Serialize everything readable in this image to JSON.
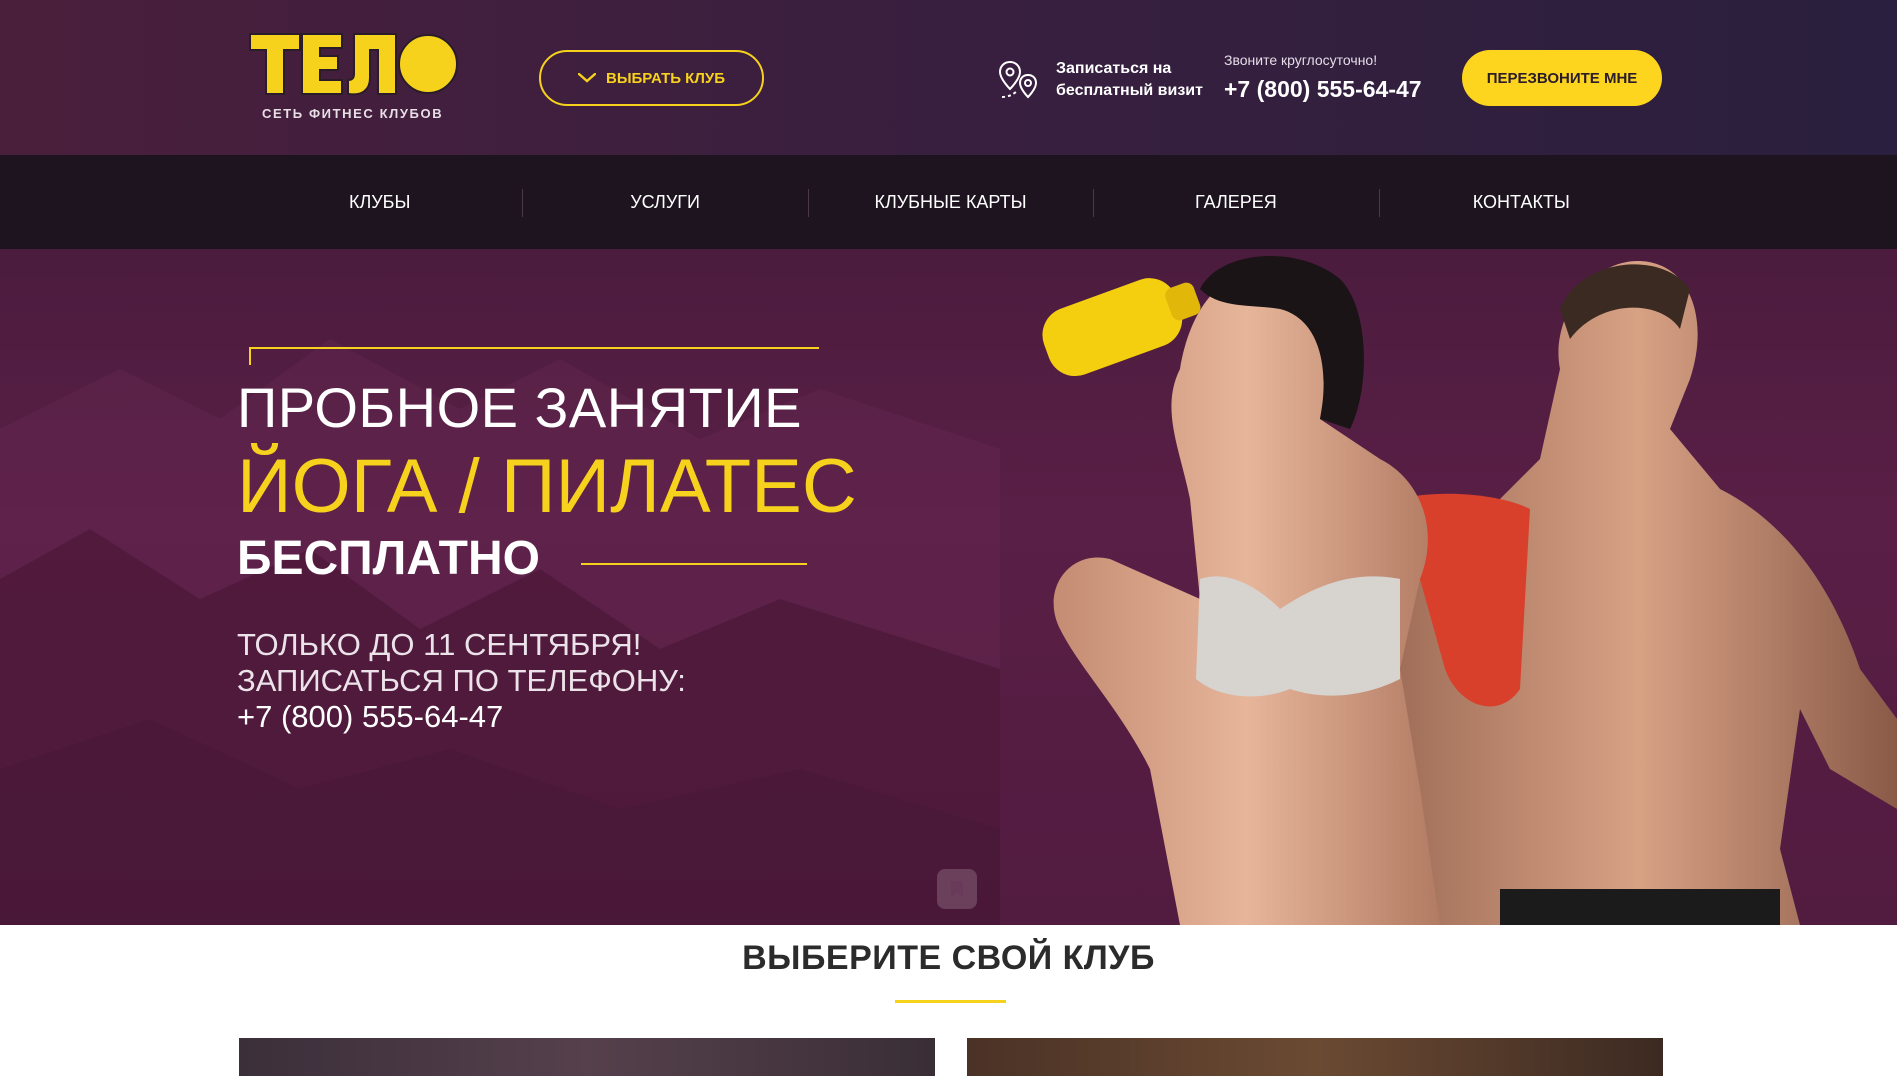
{
  "colors": {
    "accent": "#f7d21c",
    "header_bg": "#3a1f3f",
    "nav_bg": "#1d1420",
    "hero_bg": "#521b40"
  },
  "header": {
    "logo_text": "ТЕЛО",
    "logo_subtitle": "СЕТЬ ФИТНЕС КЛУБОВ",
    "select_club_label": "ВЫБРАТЬ КЛУБ",
    "select_club_icon": "chevron-down-icon",
    "visit_icon": "map-pin-route-icon",
    "visit_line1": "Записаться на",
    "visit_line2": "бесплатный визит",
    "phone_note": "Звоните круглосуточно!",
    "phone": "+7 (800) 555-64-47",
    "callback_label": "ПЕРЕЗВОНИТЕ МНЕ"
  },
  "nav": {
    "items": [
      {
        "label": "КЛУБЫ"
      },
      {
        "label": "УСЛУГИ"
      },
      {
        "label": "КЛУБНЫЕ КАРТЫ"
      },
      {
        "label": "ГАЛЕРЕЯ"
      },
      {
        "label": "КОНТАКТЫ"
      }
    ]
  },
  "hero": {
    "line1": "ПРОБНОЕ ЗАНЯТИЕ",
    "line2": "ЙОГА / ПИЛАТЕС",
    "line3": "БЕСПЛАТНО",
    "until": "ТОЛЬКО ДО 11 СЕНТЯБРЯ!",
    "call": "ЗАПИСАТЬСЯ ПО ТЕЛЕФОНУ:",
    "phone": "+7 (800) 555-64-47",
    "slider_icon": "bookmark-icon"
  },
  "clubs": {
    "title": "ВЫБЕРИТЕ СВОЙ КЛУБ"
  }
}
